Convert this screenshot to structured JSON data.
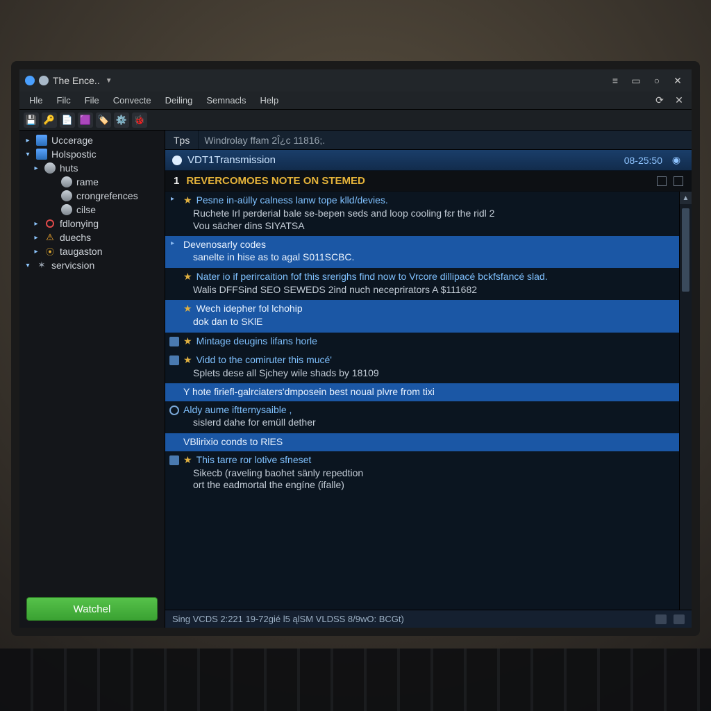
{
  "titlebar": {
    "title": "The Ence.."
  },
  "menu": {
    "items": [
      "Hle",
      "Filc",
      "File",
      "Convecte",
      "Deiling",
      "Semnacls",
      "Help"
    ]
  },
  "toolbar": {
    "icons": [
      "save-icon",
      "key-icon",
      "doc-icon",
      "cube-icon",
      "tag-icon",
      "gear-icon",
      "bug-icon"
    ]
  },
  "sidebar": {
    "button": "Watchel",
    "nodes": [
      {
        "depth": 0,
        "label": "Uccerage",
        "icon": "folder",
        "twist": "▸"
      },
      {
        "depth": 0,
        "label": "Holspostic",
        "icon": "folder",
        "twist": "▾"
      },
      {
        "depth": 1,
        "label": "huts",
        "icon": "user",
        "twist": "▸"
      },
      {
        "depth": 2,
        "label": "rame",
        "icon": "user",
        "twist": ""
      },
      {
        "depth": 2,
        "label": "crongrefences",
        "icon": "user",
        "twist": ""
      },
      {
        "depth": 2,
        "label": "cilse",
        "icon": "user",
        "twist": ""
      },
      {
        "depth": 1,
        "label": "fdlonying",
        "icon": "red",
        "twist": "▸"
      },
      {
        "depth": 1,
        "label": "duechs",
        "icon": "warn",
        "twist": "▸"
      },
      {
        "depth": 1,
        "label": "taugaston",
        "icon": "key",
        "twist": "▸"
      },
      {
        "depth": 0,
        "label": "servicsion",
        "icon": "gear",
        "twist": "▾"
      }
    ]
  },
  "tabs": {
    "active": "Tps",
    "filler": "Windrolay ffam 2Î¿c 11816;."
  },
  "section": {
    "title": "VDT1Transmission",
    "timestamp": "08-25:50"
  },
  "banner": {
    "num": "1",
    "text": "REVERCOMOES NOTE ON STEMED"
  },
  "rows": [
    {
      "hl": false,
      "twist": "▸",
      "star": true,
      "icon": "",
      "title": "Pesne in-aülly calness lanw tope klld/devies.",
      "body": "Ruchete Irl perderial bale se-bepen seds and loop cooling fɛr the ridl 2\nVou sächer dins SIYATSA"
    },
    {
      "hl": true,
      "twist": "▸",
      "star": false,
      "icon": "",
      "title": "Devenosarly codes",
      "body": "sanelte in hise as to agal S011SCBC."
    },
    {
      "hl": false,
      "twist": "",
      "star": true,
      "icon": "",
      "title": "Nater io if perircaition fof this srerighs find now to Vrcore dillipacé bckfsfancé slad.",
      "body": "Walis DFFSind SEO SEWEDS 2ind nuch neceprirators A $111682"
    },
    {
      "hl": true,
      "twist": "",
      "star": true,
      "icon": "",
      "title": "Wech idepher fol lchohip",
      "body": "dok dan to SKlE"
    },
    {
      "hl": false,
      "twist": "",
      "star": true,
      "icon": "doc",
      "title": "Mintage deugins lifans horle",
      "body": ""
    },
    {
      "hl": false,
      "twist": "",
      "star": true,
      "icon": "doc",
      "title": "Vidd to the comiruter this mucé'",
      "body": "Splets dese all Sjchey wile shads by 18109"
    },
    {
      "hl": true,
      "twist": "",
      "star": false,
      "icon": "",
      "title": "Y hote firiefl-galrciaters'dmposein best noual plvre from tixi",
      "body": ""
    },
    {
      "hl": false,
      "twist": "",
      "star": false,
      "icon": "circle",
      "title": "Aldy aume iftternysaible ,",
      "body": "sislerd dahe for emüll dether"
    },
    {
      "hl": true,
      "twist": "",
      "star": false,
      "icon": "",
      "title": "VBlirixio conds to RlES",
      "body": ""
    },
    {
      "hl": false,
      "twist": "",
      "star": true,
      "icon": "doc",
      "title": "This tarre ror lotive sfneset",
      "body": "Sikecb (raveling baohet sänly repedtion\nort the eadmortal the engíne (ifalle)"
    }
  ],
  "status": {
    "text": "Sing  VCDS 2:221 19-72gié l5 ąlSM VLDSS 8/9wO: BCGt)"
  }
}
